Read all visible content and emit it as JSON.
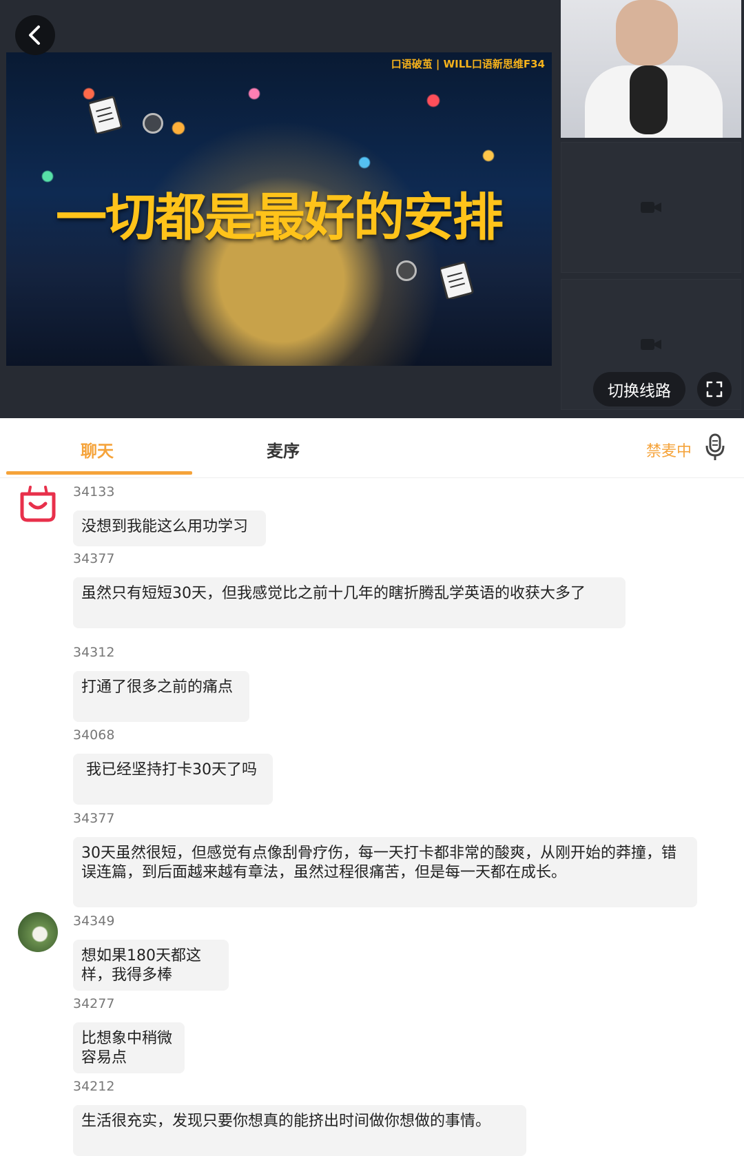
{
  "video": {
    "slide_logo": "口语破茧 | WILL口语新思维F34",
    "slide_title": "一切都是最好的安排",
    "switch_line_label": "切换线路"
  },
  "tabs": {
    "chat_label": "聊天",
    "mic_order_label": "麦序",
    "mute_status": "禁麦中"
  },
  "messages": [
    {
      "user": "34133",
      "text": "没想到我能这么用功学习"
    },
    {
      "user": "34377",
      "text": "虽然只有短短30天，但我感觉比之前十几年的瞎折腾乱学英语的收获大多了"
    },
    {
      "user": "34312",
      "text": "打通了很多之前的痛点"
    },
    {
      "user": "34068",
      "text": " 我已经坚持打卡30天了吗"
    },
    {
      "user": "34377",
      "text": "30天虽然很短，但感觉有点像刮骨疗伤，每一天打卡都非常的酸爽，从刚开始的莽撞，错误连篇，到后面越来越有章法，虽然过程很痛苦，但是每一天都在成长。"
    },
    {
      "user": "34349",
      "text": "想如果180天都这样，我得多棒"
    },
    {
      "user": "34277",
      "text": "比想象中稍微容易点"
    },
    {
      "user": "34212",
      "text": "生活很充实，发现只要你想真的能挤出时间做你想做的事情。"
    }
  ]
}
